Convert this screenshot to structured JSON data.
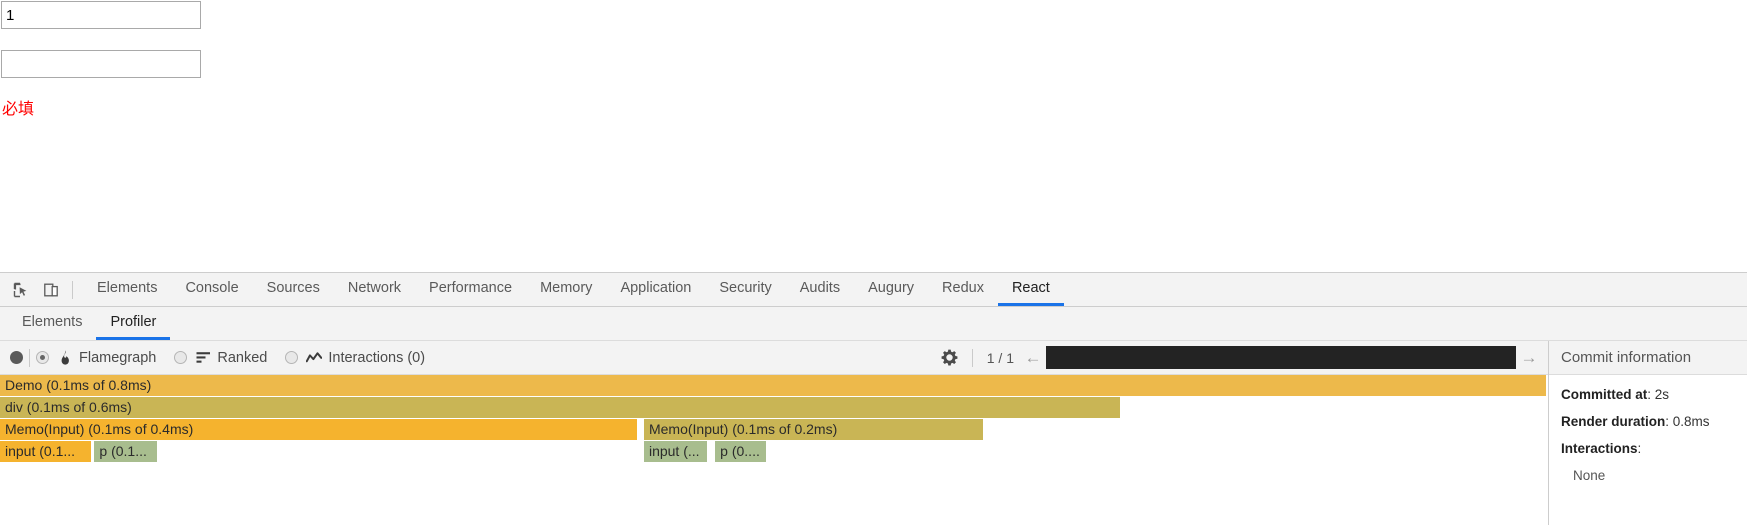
{
  "page": {
    "inputs": [
      {
        "name": "first-input",
        "value": "1",
        "placeholder": ""
      },
      {
        "name": "second-input",
        "value": "",
        "placeholder": ""
      }
    ],
    "validation_message": "必填"
  },
  "devtools": {
    "icons": {
      "inspect": "inspect-element-icon",
      "device": "device-toolbar-icon"
    },
    "main_tabs": [
      {
        "label": "Elements",
        "active": false
      },
      {
        "label": "Console",
        "active": false
      },
      {
        "label": "Sources",
        "active": false
      },
      {
        "label": "Network",
        "active": false
      },
      {
        "label": "Performance",
        "active": false
      },
      {
        "label": "Memory",
        "active": false
      },
      {
        "label": "Application",
        "active": false
      },
      {
        "label": "Security",
        "active": false
      },
      {
        "label": "Audits",
        "active": false
      },
      {
        "label": "Augury",
        "active": false
      },
      {
        "label": "Redux",
        "active": false
      },
      {
        "label": "React",
        "active": true
      }
    ],
    "sub_tabs": [
      {
        "label": "Elements",
        "active": false
      },
      {
        "label": "Profiler",
        "active": true
      }
    ],
    "accent_color": "#1a73e8"
  },
  "profiler_toolbar": {
    "record_button": "record-button",
    "view_modes": [
      {
        "label": "Flamegraph",
        "icon": "flame-icon",
        "selected": true
      },
      {
        "label": "Ranked",
        "icon": "ranked-bars-icon",
        "selected": false
      },
      {
        "label": "Interactions (0)",
        "icon": "interactions-line-icon",
        "selected": false
      }
    ],
    "settings_icon": "gear-icon",
    "snapshot_counter": "1 / 1",
    "prev_label": "←",
    "next_label": "→",
    "commit_bar_color": "#232323"
  },
  "chart_data": {
    "type": "flamegraph",
    "title": "React Profiler Flamegraph",
    "total_duration_ms": 0.8,
    "rows": [
      {
        "depth": 0,
        "bars": [
          {
            "label": "Demo (0.1ms of 0.8ms)",
            "name": "Demo",
            "self_ms": 0.1,
            "total_ms": 0.8,
            "left_pct": 0.0,
            "width_pct": 100.0,
            "color": "#edb94b"
          }
        ]
      },
      {
        "depth": 1,
        "bars": [
          {
            "label": "div (0.1ms of 0.6ms)",
            "name": "div",
            "self_ms": 0.1,
            "total_ms": 0.6,
            "left_pct": 0.0,
            "width_pct": 72.5,
            "color": "#c9b555"
          }
        ]
      },
      {
        "depth": 2,
        "bars": [
          {
            "label": "Memo(Input) (0.1ms of 0.4ms)",
            "name": "Memo(Input)",
            "self_ms": 0.1,
            "total_ms": 0.4,
            "left_pct": 0.0,
            "width_pct": 41.3,
            "color": "#f5b32e"
          },
          {
            "label": "Memo(Input) (0.1ms of 0.2ms)",
            "name": "Memo(Input)",
            "self_ms": 0.1,
            "total_ms": 0.2,
            "left_pct": 41.6,
            "width_pct": 22.0,
            "color": "#c9b555"
          }
        ]
      },
      {
        "depth": 3,
        "bars": [
          {
            "label": "input (0.1...",
            "name": "input",
            "self_ms": 0.1,
            "total_ms": 0.1,
            "left_pct": 0.0,
            "width_pct": 6.0,
            "color": "#f5b32e"
          },
          {
            "label": "p (0.1...",
            "name": "p",
            "self_ms": 0.1,
            "total_ms": 0.1,
            "left_pct": 6.1,
            "width_pct": 4.2,
            "color": "#a8bd8e"
          },
          {
            "label": "input (...",
            "name": "input",
            "self_ms": 0.1,
            "total_ms": 0.1,
            "left_pct": 41.6,
            "width_pct": 4.2,
            "color": "#a8bd8e"
          },
          {
            "label": "p (0....",
            "name": "p",
            "self_ms": 0.1,
            "total_ms": 0.1,
            "left_pct": 46.2,
            "width_pct": 3.4,
            "color": "#a8bd8e"
          }
        ]
      }
    ]
  },
  "commit_sidebar": {
    "header": "Commit information",
    "committed_at_label": "Committed at",
    "committed_at_value": "2s",
    "render_duration_label": "Render duration",
    "render_duration_value": "0.8ms",
    "interactions_label": "Interactions",
    "interactions_value": "None"
  }
}
